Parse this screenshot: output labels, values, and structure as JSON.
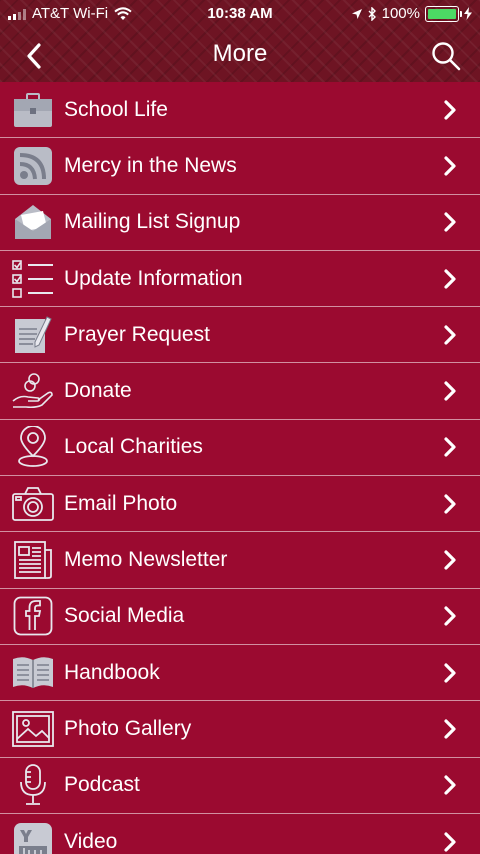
{
  "status_bar": {
    "carrier": "AT&T Wi-Fi",
    "time": "10:38 AM",
    "battery": "100%",
    "battery_color": "#4cd964"
  },
  "nav": {
    "title": "More",
    "back_icon": "chevron-left-icon",
    "search_icon": "search-icon"
  },
  "colors": {
    "header_bg": "#6e1423",
    "list_bg": "#9b0a30",
    "divider": "#ffffff"
  },
  "menu": {
    "items": [
      {
        "label": "School Life",
        "icon": "briefcase-icon"
      },
      {
        "label": "Mercy in the News",
        "icon": "rss-icon"
      },
      {
        "label": "Mailing List Signup",
        "icon": "envelope-icon"
      },
      {
        "label": "Update Information",
        "icon": "checklist-icon"
      },
      {
        "label": "Prayer Request",
        "icon": "document-pen-icon"
      },
      {
        "label": "Donate",
        "icon": "donate-hand-icon"
      },
      {
        "label": "Local Charities",
        "icon": "map-pin-icon"
      },
      {
        "label": "Email Photo",
        "icon": "camera-icon"
      },
      {
        "label": "Memo Newsletter",
        "icon": "newspaper-icon"
      },
      {
        "label": "Social Media",
        "icon": "facebook-icon"
      },
      {
        "label": "Handbook",
        "icon": "open-book-icon"
      },
      {
        "label": "Photo Gallery",
        "icon": "image-icon"
      },
      {
        "label": "Podcast",
        "icon": "microphone-icon"
      },
      {
        "label": "Video",
        "icon": "youtube-icon"
      }
    ]
  }
}
